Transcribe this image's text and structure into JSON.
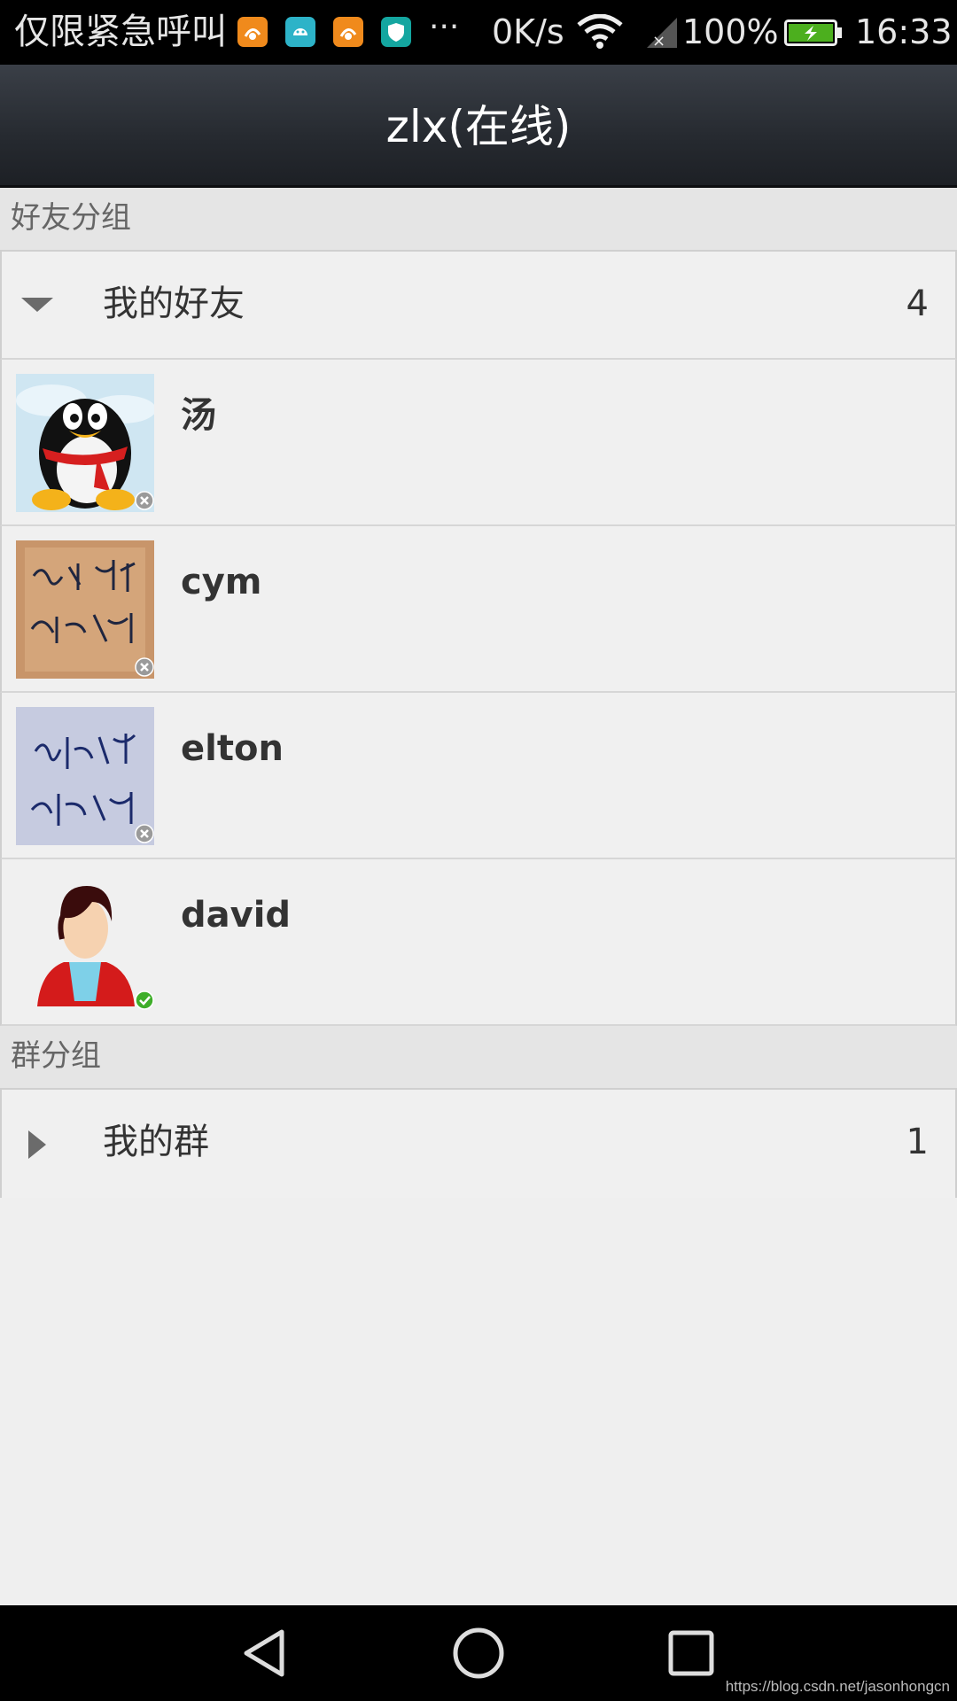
{
  "status_bar": {
    "carrier": "仅限紧急呼叫",
    "net_speed": "0K/s",
    "battery": "100%",
    "time": "16:33",
    "app_icons": [
      "uc-browser-icon",
      "android-icon",
      "uc-browser-icon",
      "shield-icon"
    ]
  },
  "header": {
    "title": "zlx(在线)"
  },
  "sections": {
    "friends": {
      "label": "好友分组",
      "group": {
        "name": "我的好友",
        "count": "4",
        "expanded": true
      },
      "items": [
        {
          "name": "汤",
          "status": "offline"
        },
        {
          "name": "cym",
          "status": "offline"
        },
        {
          "name": "elton",
          "status": "offline"
        },
        {
          "name": "david",
          "status": "online"
        }
      ]
    },
    "groups": {
      "label": "群分组",
      "group": {
        "name": "我的群",
        "count": "1",
        "expanded": false
      }
    }
  },
  "watermark": "https://blog.csdn.net/jasonhongcn",
  "colors": {
    "online": "#3fae2a",
    "offline": "#9a9a9a",
    "titlebar": "#262a30"
  }
}
